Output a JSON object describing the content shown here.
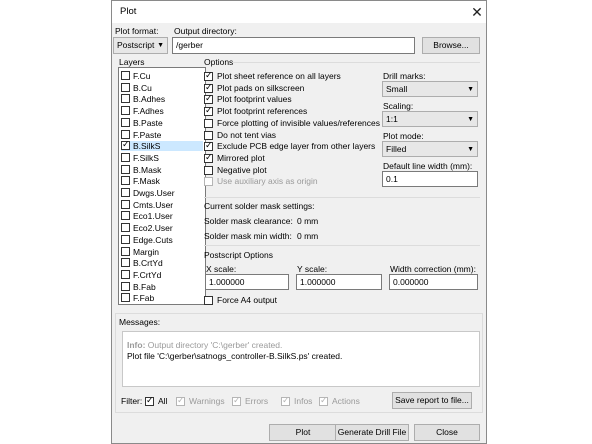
{
  "window": {
    "title": "Plot",
    "close_glyph": "✕"
  },
  "plot_format": {
    "label": "Plot format:",
    "value": "Postscript"
  },
  "output_dir": {
    "label": "Output directory:",
    "value": "/gerber",
    "browse": "Browse..."
  },
  "layers": {
    "header": "Layers",
    "items": [
      {
        "name": "F.Cu",
        "checked": false
      },
      {
        "name": "B.Cu",
        "checked": false
      },
      {
        "name": "B.Adhes",
        "checked": false
      },
      {
        "name": "F.Adhes",
        "checked": false
      },
      {
        "name": "B.Paste",
        "checked": false
      },
      {
        "name": "F.Paste",
        "checked": false
      },
      {
        "name": "B.SilkS",
        "checked": true,
        "selected": true
      },
      {
        "name": "F.SilkS",
        "checked": false
      },
      {
        "name": "B.Mask",
        "checked": false
      },
      {
        "name": "F.Mask",
        "checked": false
      },
      {
        "name": "Dwgs.User",
        "checked": false
      },
      {
        "name": "Cmts.User",
        "checked": false
      },
      {
        "name": "Eco1.User",
        "checked": false
      },
      {
        "name": "Eco2.User",
        "checked": false
      },
      {
        "name": "Edge.Cuts",
        "checked": false
      },
      {
        "name": "Margin",
        "checked": false
      },
      {
        "name": "B.CrtYd",
        "checked": false
      },
      {
        "name": "F.CrtYd",
        "checked": false
      },
      {
        "name": "B.Fab",
        "checked": false
      },
      {
        "name": "F.Fab",
        "checked": false
      }
    ]
  },
  "options": {
    "header": "Options",
    "items": [
      {
        "label": "Plot sheet reference on all layers",
        "checked": true,
        "disabled": false
      },
      {
        "label": "Plot pads on silkscreen",
        "checked": true,
        "disabled": false
      },
      {
        "label": "Plot footprint values",
        "checked": true,
        "disabled": false
      },
      {
        "label": "Plot footprint references",
        "checked": true,
        "disabled": false
      },
      {
        "label": "Force plotting of invisible values/references",
        "checked": false,
        "disabled": false
      },
      {
        "label": "Do not tent vias",
        "checked": false,
        "disabled": false
      },
      {
        "label": "Exclude PCB edge layer from other layers",
        "checked": true,
        "disabled": false
      },
      {
        "label": "Mirrored plot",
        "checked": true,
        "disabled": false
      },
      {
        "label": "Negative plot",
        "checked": false,
        "disabled": false
      },
      {
        "label": "Use auxiliary axis as origin",
        "checked": false,
        "disabled": true
      }
    ],
    "drill_marks": {
      "label": "Drill marks:",
      "value": "Small"
    },
    "scaling": {
      "label": "Scaling:",
      "value": "1:1"
    },
    "plot_mode": {
      "label": "Plot mode:",
      "value": "Filled"
    },
    "line_width": {
      "label": "Default line width (mm):",
      "value": "0.1"
    }
  },
  "solder_mask": {
    "header": "Current solder mask settings:",
    "clearance_label": "Solder mask clearance:",
    "clearance_value": "0 mm",
    "min_width_label": "Solder mask min width:",
    "min_width_value": "0 mm"
  },
  "postscript": {
    "header": "Postscript Options",
    "x_scale": {
      "label": "X scale:",
      "value": "1.000000"
    },
    "y_scale": {
      "label": "Y scale:",
      "value": "1.000000"
    },
    "width_corr": {
      "label": "Width correction (mm):",
      "value": "0.000000"
    },
    "force_a4": {
      "label": "Force A4 output",
      "checked": false
    }
  },
  "messages": {
    "header": "Messages:",
    "line1_prefix": "Info:",
    "line1_text": " Output directory 'C:\\gerber' created.",
    "line2": "Plot file 'C:\\gerber\\satnogs_controller-B.SilkS.ps' created."
  },
  "filter": {
    "label": "Filter:",
    "items": [
      {
        "label": "All",
        "checked": true,
        "disabled": false
      },
      {
        "label": "Warnings",
        "checked": true,
        "disabled": true
      },
      {
        "label": "Errors",
        "checked": true,
        "disabled": true
      },
      {
        "label": "Infos",
        "checked": true,
        "disabled": true
      },
      {
        "label": "Actions",
        "checked": true,
        "disabled": true
      }
    ],
    "save_report": "Save report to file..."
  },
  "buttons": {
    "plot": "Plot",
    "drill": "Generate Drill File",
    "close": "Close"
  }
}
